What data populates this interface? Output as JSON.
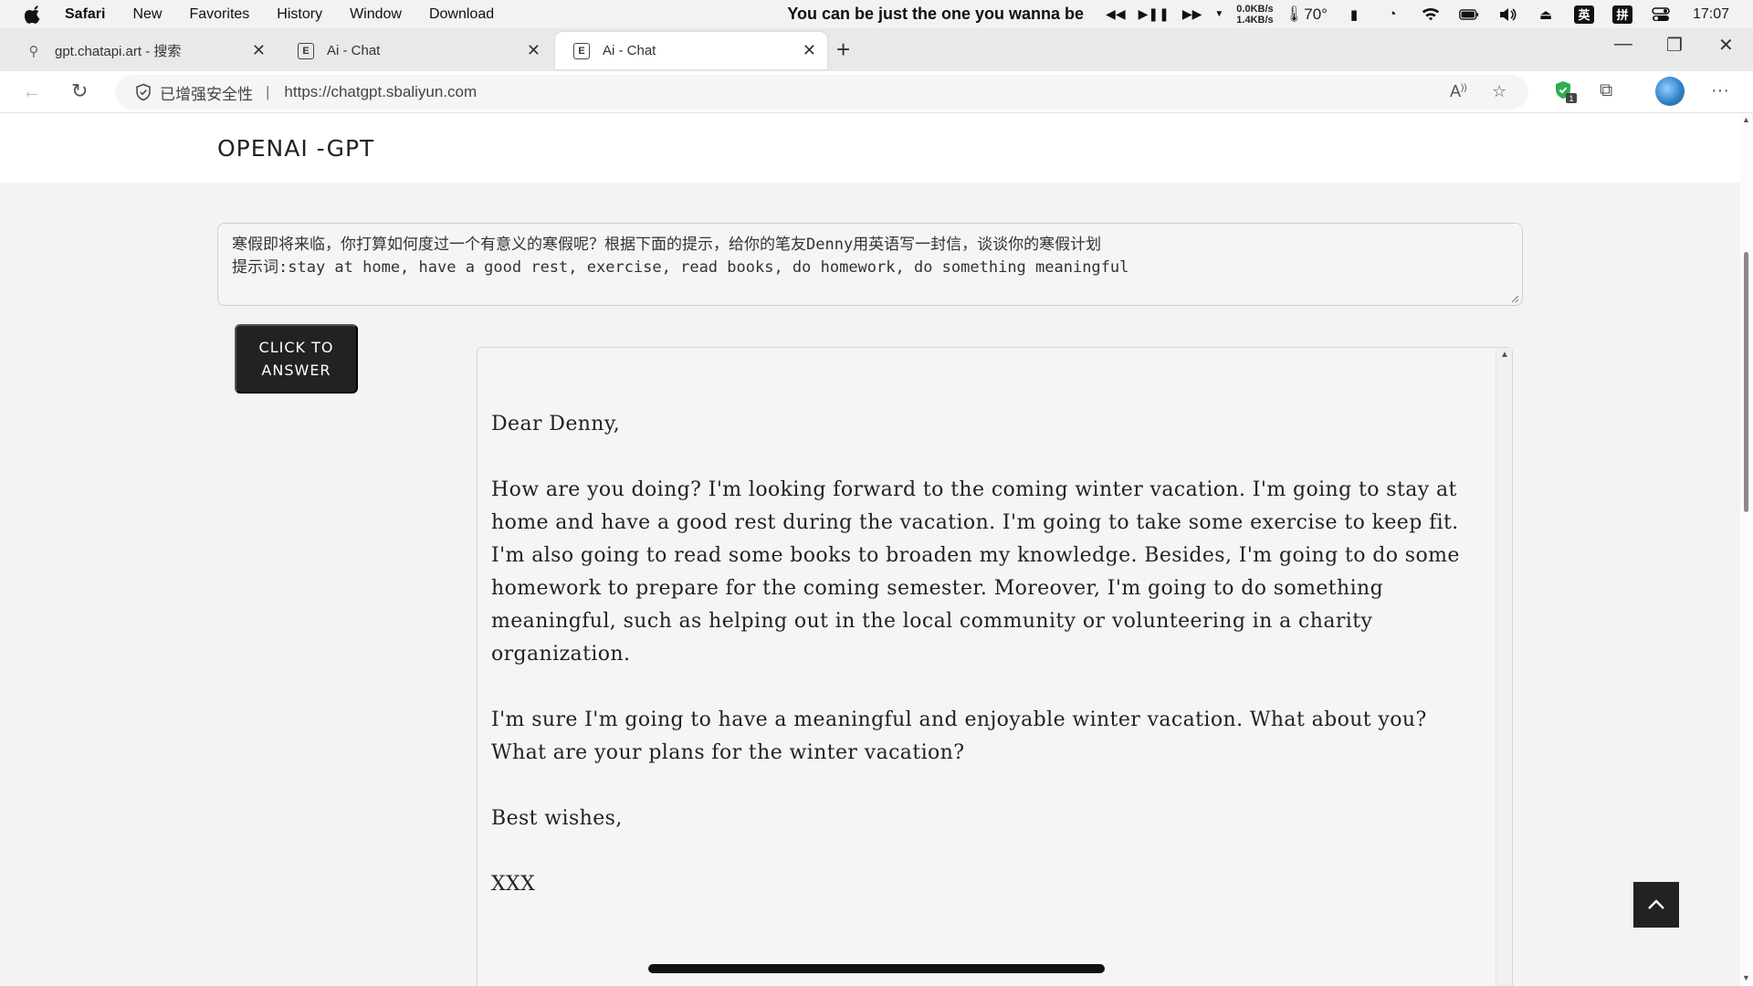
{
  "menubar": {
    "app": "Safari",
    "items": [
      "New",
      "Favorites",
      "History",
      "Window",
      "Download"
    ],
    "now_playing": "You can be just the one you wanna be",
    "net_up": "0.0KB/s",
    "net_down": "1.4KB/s",
    "temperature": "70°",
    "ime_lang": "英",
    "ime_mode": "拼",
    "clock": "17:07"
  },
  "tabs": [
    {
      "title": "gpt.chatapi.art - 搜索",
      "favicon": "search-icon"
    },
    {
      "title": "Ai - Chat",
      "favicon": "E"
    },
    {
      "title": "Ai - Chat",
      "favicon": "E",
      "active": true
    }
  ],
  "toolbar": {
    "secure_label": "已增强安全性",
    "separator": "|",
    "url": "https://chatgpt.sbaliyun.com",
    "extension_badge": "1"
  },
  "page": {
    "title": "OPENAI -GPT",
    "prompt": "寒假即将来临，你打算如何度过一个有意义的寒假呢？根据下面的提示，给你的笔友Denny用英语写一封信，谈谈你的寒假计划\n提示词:stay at home, have a good rest, exercise, read books, do homework, do something meaningful",
    "answer_button": "CLICK TO\nANSWER",
    "answer": "Dear Denny,\n\nHow are you doing? I'm looking forward to the coming winter vacation. I'm going to stay at home and have a good rest during the vacation. I'm going to take some exercise to keep fit. I'm also going to read some books to broaden my knowledge. Besides, I'm going to do some homework to prepare for the coming semester. Moreover, I'm going to do something meaningful, such as helping out in the local community or volunteering in a charity organization.\n\nI'm sure I'm going to have a meaningful and enjoyable winter vacation. What about you? What are your plans for the winter vacation?\n\nBest wishes,\n\nXXX"
  }
}
